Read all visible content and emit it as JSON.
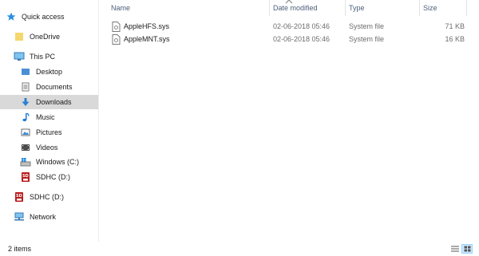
{
  "sidebar": {
    "quick_access": {
      "label": "Quick access",
      "icon": "star-icon"
    },
    "onedrive": {
      "label": "OneDrive",
      "icon": "folder-icon"
    },
    "this_pc": {
      "label": "This PC",
      "icon": "computer-icon"
    },
    "items": [
      {
        "label": "Desktop",
        "icon": "desktop-icon"
      },
      {
        "label": "Documents",
        "icon": "documents-icon"
      },
      {
        "label": "Downloads",
        "icon": "download-arrow-icon",
        "selected": true
      },
      {
        "label": "Music",
        "icon": "music-note-icon"
      },
      {
        "label": "Pictures",
        "icon": "pictures-icon"
      },
      {
        "label": "Videos",
        "icon": "videos-icon"
      },
      {
        "label": "Windows (C:)",
        "icon": "windows-drive-icon"
      },
      {
        "label": "SDHC (D:)",
        "icon": "sd-card-icon"
      }
    ],
    "sdhc_root": {
      "label": "SDHC (D:)",
      "icon": "sd-card-icon"
    },
    "network": {
      "label": "Network",
      "icon": "network-icon"
    }
  },
  "columns": {
    "name": "Name",
    "date_modified": "Date modified",
    "type": "Type",
    "size": "Size"
  },
  "files": [
    {
      "name": "AppleHFS.sys",
      "date": "02-06-2018 05:46",
      "type": "System file",
      "size": "71 KB"
    },
    {
      "name": "AppleMNT.sys",
      "date": "02-06-2018 05:46",
      "type": "System file",
      "size": "16 KB"
    }
  ],
  "status": {
    "item_count": "2 items"
  },
  "colors": {
    "selected_bg": "#d9d9d9",
    "header_text": "#4c607a",
    "accent": "#0078d7"
  }
}
